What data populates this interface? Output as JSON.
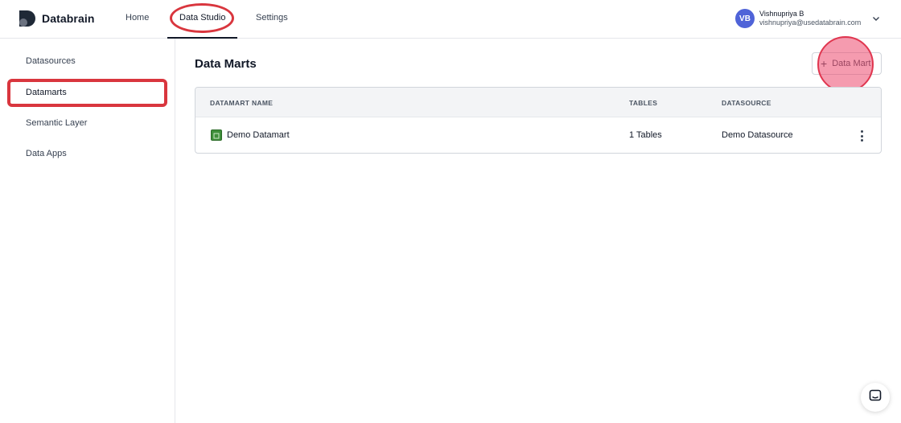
{
  "app": {
    "name": "Databrain"
  },
  "nav": {
    "home": "Home",
    "data_studio": "Data Studio",
    "settings": "Settings"
  },
  "user": {
    "initials": "VB",
    "name": "Vishnupriya B",
    "email": "vishnupriya@usedatabrain.com"
  },
  "sidebar": {
    "items": [
      {
        "label": "Datasources"
      },
      {
        "label": "Datamarts"
      },
      {
        "label": "Semantic Layer"
      },
      {
        "label": "Data Apps"
      }
    ]
  },
  "main": {
    "title": "Data Marts",
    "add_button": "Data Mart",
    "table": {
      "headers": [
        "DATAMART NAME",
        "TABLES",
        "DATASOURCE"
      ],
      "rows": [
        {
          "name": "Demo Datamart",
          "tables": "1 Tables",
          "datasource": "Demo Datasource"
        }
      ]
    }
  },
  "colors": {
    "annotation": "#d9363e",
    "avatar": "#4f63d8"
  }
}
